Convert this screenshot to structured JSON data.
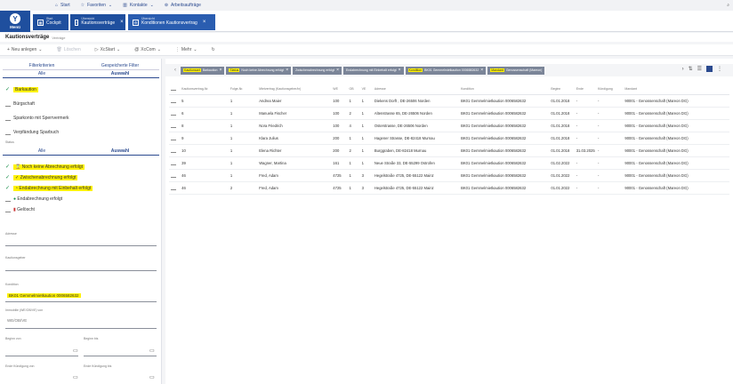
{
  "topnav": {
    "start": "Start",
    "favoriten": "Favoriten",
    "kontakte": "Kontakte",
    "arbeitsauftraege": "Arbeitsaufträge"
  },
  "appbar": {
    "logo_letter": "Y",
    "menu_label": "Menü",
    "tabs": [
      {
        "small": "Start",
        "label": "Cockpit"
      },
      {
        "small": "Übersicht",
        "label": "Kautionsverträge"
      },
      {
        "small": "Übersicht",
        "label": "Konditionen Kautionsvertrag"
      }
    ]
  },
  "page": {
    "title": "Kautionsverträge",
    "subtitle": "Verträge"
  },
  "toolbar": {
    "neu_anlegen": "Neu anlegen",
    "loeschen": "Löschen",
    "xstart": "XcStart",
    "xcom": "XcCom",
    "mehr": "Mehr"
  },
  "filters": {
    "tab_filterkriterien": "Filterkriterien",
    "tab_gespeicherte": "Gespeicherte Filter",
    "seg1": {
      "alle": "Alle",
      "auswahl": "Auswahl"
    },
    "art_items": [
      {
        "label": "Barkaution",
        "checked": true,
        "highlight": true
      },
      {
        "label": "Bürgschaft",
        "checked": false,
        "highlight": false
      },
      {
        "label": "Sparkonto mit Sperrvermerk",
        "checked": false,
        "highlight": false
      },
      {
        "label": "Verpfändung Sparbuch",
        "checked": false,
        "highlight": false
      }
    ],
    "status_label": "Status",
    "seg2": {
      "alle": "Alle",
      "auswahl": "Auswahl"
    },
    "status_items": [
      {
        "label": "Noch keine Abrechnung erfolgt",
        "checked": true,
        "highlight": true
      },
      {
        "label": "Zwischenabrechnung erfolgt",
        "checked": true,
        "highlight": true
      },
      {
        "label": "Endabrechnung mit Einbehalt erfolgt",
        "checked": true,
        "highlight": true
      },
      {
        "label": "Endabrechnung erfolgt",
        "checked": false,
        "highlight": false
      },
      {
        "label": "Gelöscht",
        "checked": false,
        "highlight": false
      }
    ],
    "adresse_label": "Adresse",
    "kautionsgeber_label": "Kautionsgeber",
    "kondition_label": "Kondition",
    "kondition_value": "BK01 Gemmelmietkaution 0006582632",
    "immobilie_label": "Immobilie (WE/OB/VE) von",
    "immobilie_placeholder": "WE/OB/VE",
    "beginn_von": "Beginn von",
    "beginn_bis": "Beginn bis",
    "ende_kuendigung_von": "Ende Kündigung von",
    "ende_kuendigung_bis": "Ende Kündigung bis"
  },
  "chips": [
    {
      "key": "Kautionsart",
      "value": "Barkaution"
    },
    {
      "key": "Status",
      "value": "Noch keine Abrechnung erfolgt"
    },
    {
      "key": "",
      "value": "Zwischenabrechnung erfolgt"
    },
    {
      "key": "",
      "value": "Endabrechnung mit Einbehalt erfolgt"
    },
    {
      "key": "Kondition",
      "value": "BK01 Gemmelmietkaution 0006582632"
    },
    {
      "key": "Mandant",
      "value": "Genossenschaft (Mareon)"
    }
  ],
  "table": {
    "headers": [
      "Kautionsvertrag-Nr.",
      "Folge-Nr.",
      "Mietvertrag (Kautionsgeber/in)",
      "WE",
      "OB",
      "VE",
      "Adresse",
      "Kondition",
      "Beginn",
      "Ende",
      "Kündigung",
      "Mandant"
    ],
    "rows": [
      [
        "5",
        "1",
        "Andrea Maier",
        "100",
        "1",
        "1",
        "Diekens Dorft , DE-26506 Norden",
        "BK01 Gemmelmietkaution 0006582632",
        "01.01.2018",
        "-",
        "-",
        "90001 - Genossenschaft (Mareon DG)"
      ],
      [
        "6",
        "1",
        "Manuela Fischer",
        "100",
        "2",
        "1",
        "Altenstrasse 65, DE-26506 Norden",
        "BK01 Gemmelmietkaution 0006582632",
        "01.01.2018",
        "-",
        "-",
        "90001 - Genossenschaft (Mareon DG)"
      ],
      [
        "8",
        "1",
        "Nora Friedrich",
        "100",
        "4",
        "1",
        "Osterstrasse, DE-26506 Norden",
        "BK01 Gemmelmietkaution 0006582632",
        "01.01.2018",
        "-",
        "-",
        "90001 - Genossenschaft (Mareon DG)"
      ],
      [
        "9",
        "1",
        "Klara Julius",
        "200",
        "1",
        "1",
        "Hagener Strasse, DE-82418 Murnau",
        "BK01 Gemmelmietkaution 0006582632",
        "01.01.2018",
        "-",
        "-",
        "90001 - Genossenschaft (Mareon DG)"
      ],
      [
        "10",
        "1",
        "Elena Richter",
        "200",
        "2",
        "1",
        "Burggraben, DE-82418 Murnau",
        "BK01 Gemmelmietkaution 0006582632",
        "01.01.2018",
        "31.03.2025",
        "-",
        "90001 - Genossenschaft (Mareon DG)"
      ],
      [
        "39",
        "1",
        "Wagner, Martina",
        "161",
        "1",
        "1",
        "Neue Straße 33, DE-55299 Ostrofen",
        "BK01 Gemmelmietkaution 0006582632",
        "01.02.2022",
        "-",
        "-",
        "90001 - Genossenschaft (Mareon DG)"
      ],
      [
        "46",
        "1",
        "Fred, Adam",
        "4725",
        "1",
        "3",
        "Hegelstraße 4725, DE-55122 Mainz",
        "BK01 Gemmelmietkaution 0006582632",
        "01.01.2022",
        "-",
        "-",
        "90001 - Genossenschaft (Mareon DG)"
      ],
      [
        "46",
        "2",
        "Fred, Adam",
        "4725",
        "1",
        "3",
        "Hegelstraße 4725, DE-55122 Mainz",
        "BK01 Gemmelmietkaution 0006582632",
        "01.01.2022",
        "-",
        "-",
        "90001 - Genossenschaft (Mareon DG)"
      ]
    ]
  }
}
